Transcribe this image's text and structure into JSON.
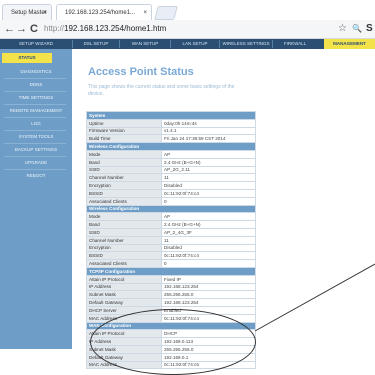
{
  "browser": {
    "tabs": [
      {
        "label": "Setup Master",
        "close": "×"
      },
      {
        "label": "192.168.123.254/home1...",
        "close": "×"
      }
    ],
    "nav": {
      "back": "←",
      "forward": "→",
      "reload": "C"
    },
    "url_prefix": "http://",
    "url_main": "192.168.123.254/home1.htm",
    "tools": {
      "star": "☆",
      "search": "🔍",
      "extra": "S"
    }
  },
  "topnav": {
    "items": [
      "SETUP WIZARD",
      "DSL SETUP",
      "WAN SETUP",
      "LAN SETUP",
      "WIRELESS SETTINGS",
      "FIREWALL",
      "MANAGEMENT"
    ],
    "active_index": 6
  },
  "sidebar": {
    "items": [
      "STATUS",
      "DIAGNOSTICS",
      "DDNS",
      "TIME SETTINGS",
      "REMOTE MANAGEMENT",
      "LOG",
      "SYSTEM TOOLS",
      "BACKUP SETTINGS",
      "UPGRADE",
      "REBOOT"
    ],
    "selected_index": 0
  },
  "main": {
    "title": "Access Point Status",
    "description": "This page shows the current status and some basic settings of the device."
  },
  "table": {
    "sections": [
      {
        "header": "System",
        "rows": [
          {
            "k": "Uptime",
            "v": "0day:0h:14m:4s"
          },
          {
            "k": "Firmware Version",
            "v": "v1.4.1"
          },
          {
            "k": "Build Time",
            "v": "Fri Jan 24 17:36:59 CST 2014"
          }
        ]
      },
      {
        "header": "Wireless Configuration",
        "rows": [
          {
            "k": "Mode",
            "v": "AP"
          },
          {
            "k": "Band",
            "v": "2.4 GHz (B+G+N)"
          },
          {
            "k": "SSID",
            "v": "AP_2G_2.11"
          },
          {
            "k": "Channel Number",
            "v": "11"
          },
          {
            "k": "Encryption",
            "v": "Disabled"
          },
          {
            "k": "BSSID",
            "v": "0c:11:92:0f:74:c4"
          },
          {
            "k": "Associated Clients",
            "v": "0"
          }
        ]
      },
      {
        "header": "Wireless Configuration",
        "rows": [
          {
            "k": "Mode",
            "v": "AP"
          },
          {
            "k": "Band",
            "v": "2.4 GHz (B+G+N)"
          },
          {
            "k": "SSID",
            "v": "AP_2_4G_3F"
          },
          {
            "k": "Channel Number",
            "v": "11"
          },
          {
            "k": "Encryption",
            "v": "Disabled"
          },
          {
            "k": "BSSID",
            "v": "0c:11:92:0f:74:c4"
          },
          {
            "k": "Associated Clients",
            "v": "0"
          }
        ]
      },
      {
        "header": "TCP/IP Configuration",
        "rows": [
          {
            "k": "Attain IP Protocol",
            "v": "Fixed IP"
          },
          {
            "k": "IP Address",
            "v": "192.168.123.254"
          },
          {
            "k": "Subnet Mask",
            "v": "255.255.255.0"
          },
          {
            "k": "Default Gateway",
            "v": "192.168.123.254"
          },
          {
            "k": "DHCP Server",
            "v": "Enabled"
          },
          {
            "k": "MAC Address",
            "v": "0c:11:92:0f:74:c4"
          }
        ]
      },
      {
        "header": "WAN Configuration",
        "rows": [
          {
            "k": "Attain IP Protocol",
            "v": "DHCP"
          },
          {
            "k": "IP Address",
            "v": "192.168.0.113"
          },
          {
            "k": "Subnet Mask",
            "v": "255.255.255.0"
          },
          {
            "k": "Default Gateway",
            "v": "192.168.0.1"
          },
          {
            "k": "MAC Address",
            "v": "0c:11:92:0f:74:c5"
          }
        ]
      }
    ]
  },
  "colors": {
    "topnav_bg": "#2a4f73",
    "sidebar_bg": "#6e9ec7",
    "active_yellow": "#f3e24a",
    "title_blue": "#7aa9d6"
  }
}
